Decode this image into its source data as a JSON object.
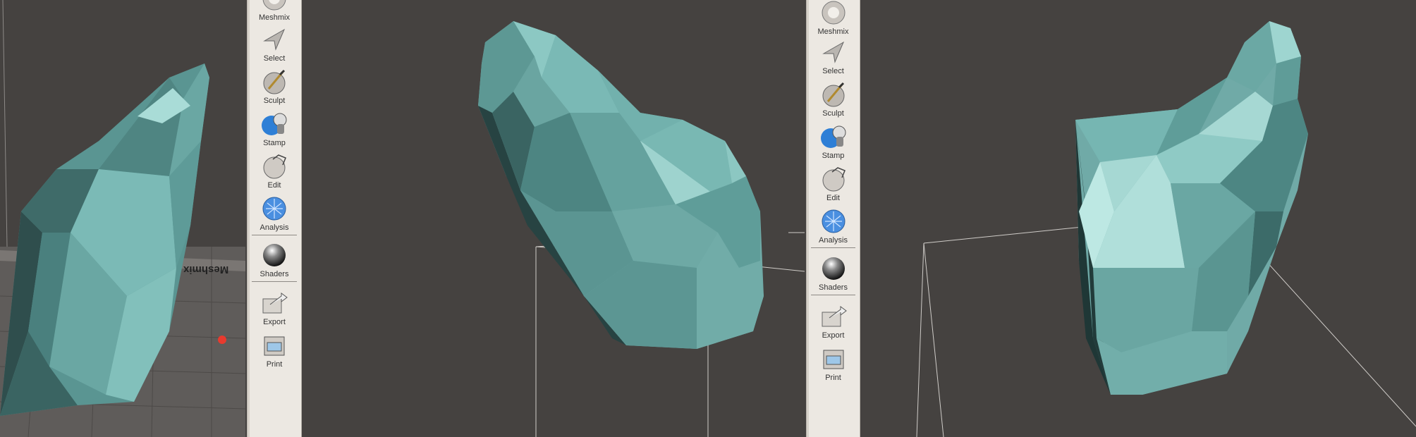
{
  "left_toolbar": {
    "tools": [
      {
        "label": "Meshmix",
        "icon": "meshmix-icon"
      },
      {
        "label": "Select",
        "icon": "select-arrow-icon"
      },
      {
        "label": "Sculpt",
        "icon": "sculpt-brush-icon"
      },
      {
        "label": "Stamp",
        "icon": "stamp-icon"
      },
      {
        "label": "Edit",
        "icon": "edit-icon"
      },
      {
        "label": "Analysis",
        "icon": "analysis-icon"
      },
      {
        "label": "Shaders",
        "icon": "shaders-sphere-icon"
      },
      {
        "label": "Export",
        "icon": "export-icon"
      },
      {
        "label": "Print",
        "icon": "print-icon"
      }
    ]
  },
  "right_toolbar": {
    "tools": [
      {
        "label": "Meshmix",
        "icon": "meshmix-icon"
      },
      {
        "label": "Select",
        "icon": "select-arrow-icon"
      },
      {
        "label": "Sculpt",
        "icon": "sculpt-brush-icon"
      },
      {
        "label": "Stamp",
        "icon": "stamp-icon"
      },
      {
        "label": "Edit",
        "icon": "edit-icon"
      },
      {
        "label": "Analysis",
        "icon": "analysis-icon"
      },
      {
        "label": "Shaders",
        "icon": "shaders-sphere-icon"
      },
      {
        "label": "Export",
        "icon": "export-icon"
      },
      {
        "label": "Print",
        "icon": "print-icon"
      }
    ]
  },
  "colors": {
    "viewport_bg": "#454240",
    "mesh_base": "#6fa9a6",
    "mesh_light": "#a9dcd7",
    "mesh_dark": "#2e4c4b",
    "toolbar_bg": "#ece8e2",
    "print_bed": "#6d6966",
    "marker_red": "#e83a2e"
  },
  "print_bed_text": "Meshmix"
}
